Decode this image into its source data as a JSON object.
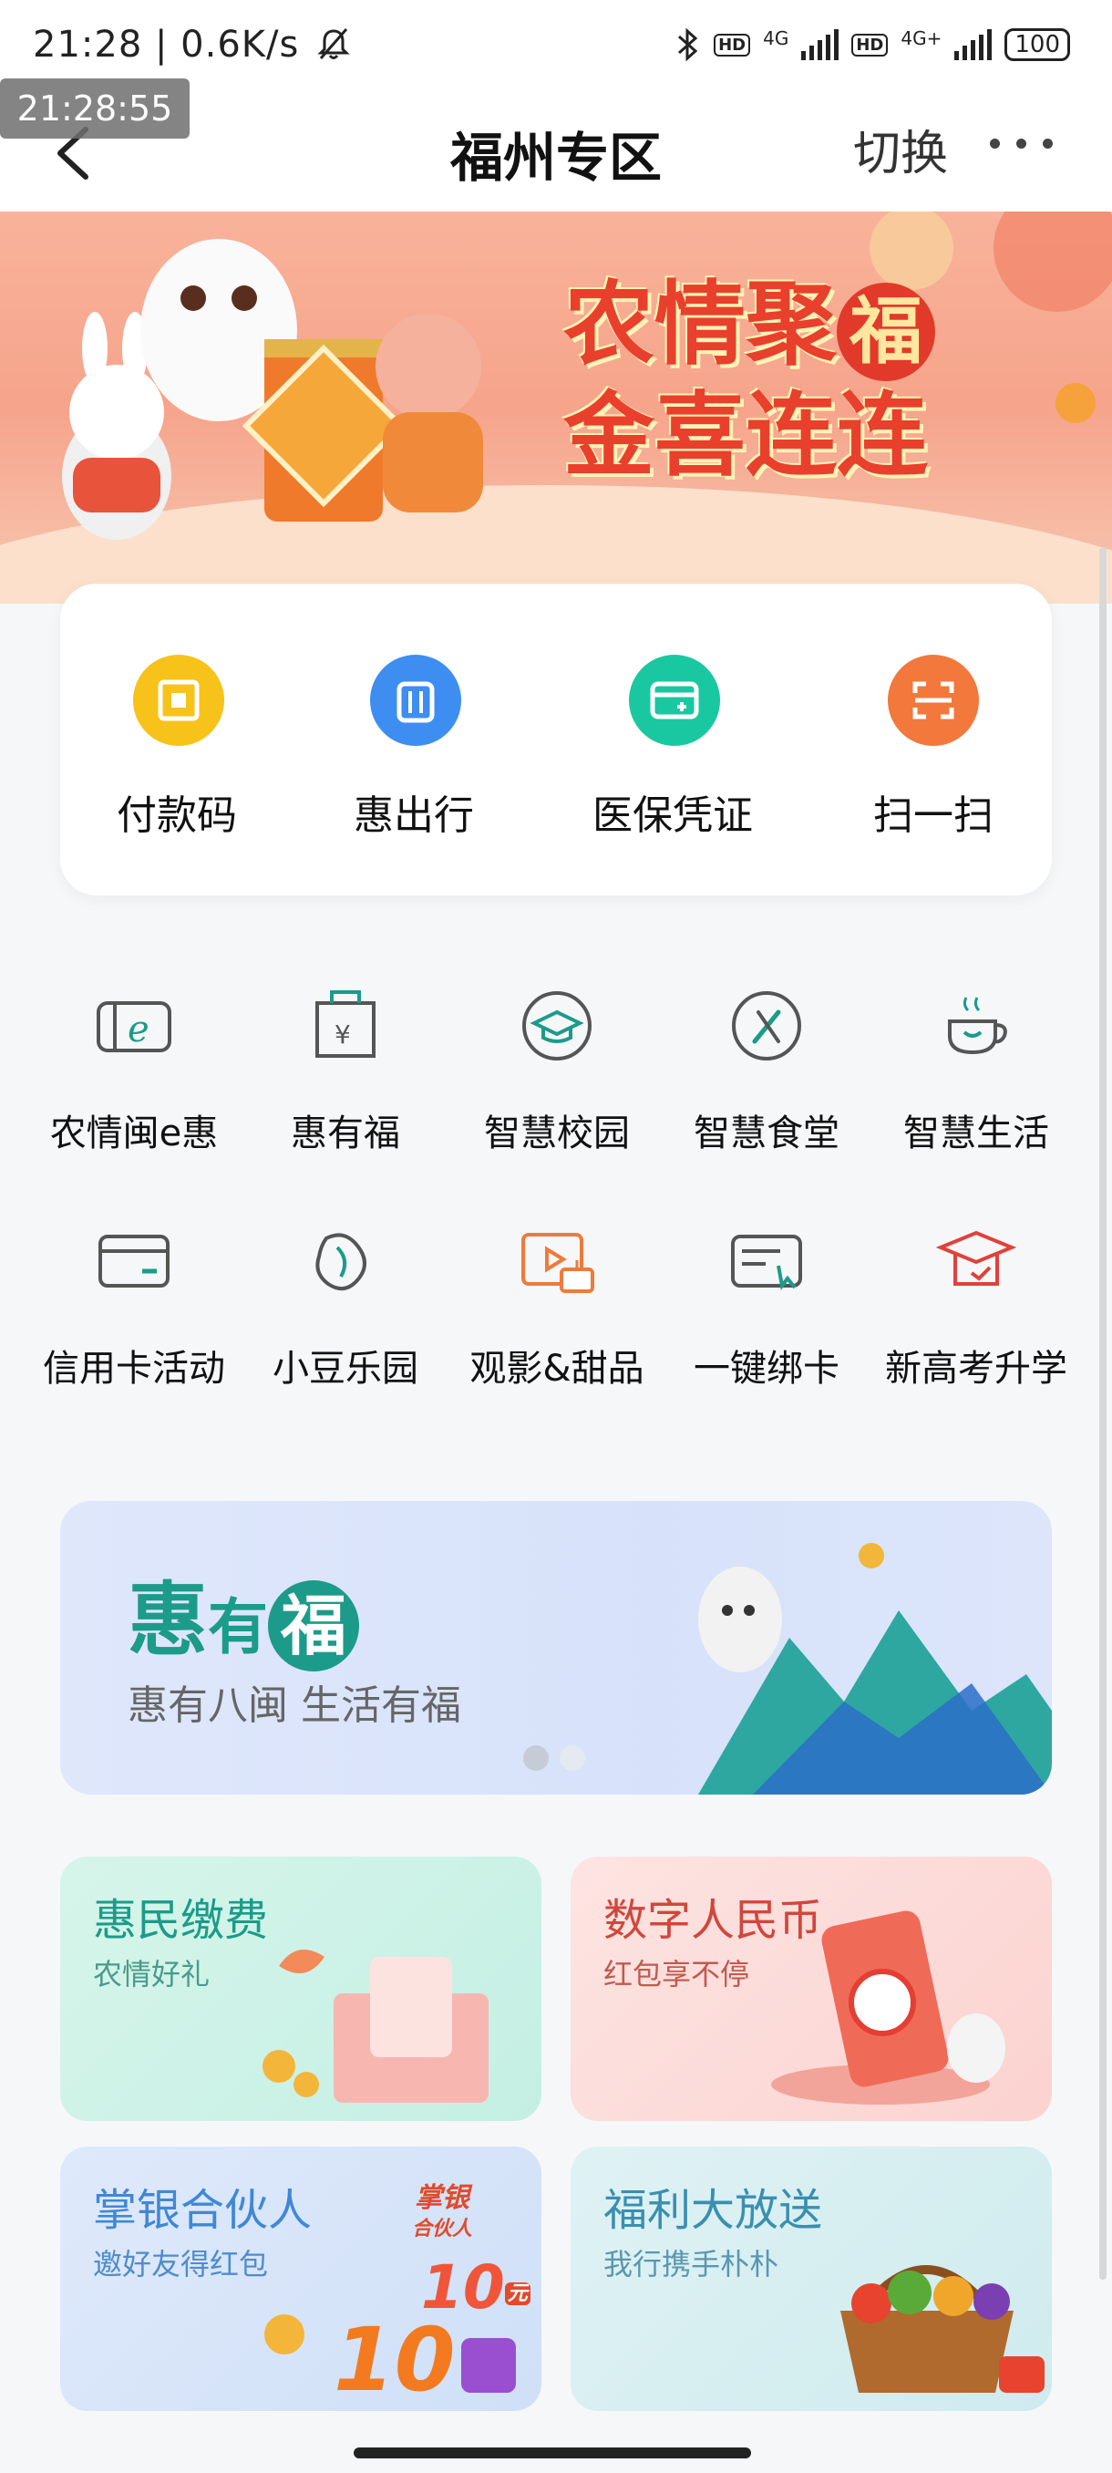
{
  "status_bar": {
    "left_text": "21:28 | 0.6K/s",
    "network_1": "4G",
    "network_2": "4G+",
    "hd_1": "HD",
    "hd_2": "HD",
    "battery": "100"
  },
  "time_badge": "21:28:55",
  "header": {
    "title": "福州专区",
    "switch_label": "切换"
  },
  "banner": {
    "line1_a": "农情聚",
    "line1_fu": "福",
    "line2": "金喜连连"
  },
  "quick_actions": [
    {
      "label": "付款码",
      "color": "#f7c31a"
    },
    {
      "label": "惠出行",
      "color": "#3d8ef0"
    },
    {
      "label": "医保凭证",
      "color": "#19c8a0"
    },
    {
      "label": "扫一扫",
      "color": "#f3783c"
    }
  ],
  "services_row1": [
    {
      "label": "农情闽e惠",
      "icon": "card-e-icon"
    },
    {
      "label": "惠有福",
      "icon": "gift-bag-icon"
    },
    {
      "label": "智慧校园",
      "icon": "graduation-cap-icon"
    },
    {
      "label": "智慧食堂",
      "icon": "fork-knife-icon"
    },
    {
      "label": "智慧生活",
      "icon": "coffee-cup-icon"
    }
  ],
  "services_row2": [
    {
      "label": "信用卡活动",
      "icon": "credit-card-icon"
    },
    {
      "label": "小豆乐园",
      "icon": "bean-icon"
    },
    {
      "label": "观影&甜品",
      "icon": "film-cake-icon"
    },
    {
      "label": "一键绑卡",
      "icon": "card-bind-icon"
    },
    {
      "label": "新高考升学",
      "icon": "education-icon"
    }
  ],
  "promo": {
    "logo_a": "惠",
    "logo_b": "有",
    "logo_c": "福",
    "subtitle": "惠有八闽 生活有福"
  },
  "tiles": [
    {
      "title": "惠民缴费",
      "subtitle": "农情好礼",
      "title_color": "#1c9b8a",
      "sub_color": "#4a9a8c"
    },
    {
      "title": "数字人民币",
      "subtitle": "红包享不停",
      "title_color": "#d0473b",
      "sub_color": "#c05a4f"
    },
    {
      "title": "掌银合伙人",
      "subtitle": "邀好友得红包",
      "title_color": "#3f88d6",
      "sub_color": "#4f8ccc"
    },
    {
      "title": "福利大放送",
      "subtitle": "我行携手朴朴",
      "title_color": "#3a8fb0",
      "sub_color": "#5a97b0"
    }
  ],
  "tile_decor": {
    "partner_badge_1": "掌银",
    "partner_badge_2": "合伙人",
    "reward_big": "10",
    "reward_small": "10",
    "reward_unit": "元"
  },
  "colors": {
    "accent_green": "#1c9b8a",
    "banner_red": "#e8402c"
  }
}
